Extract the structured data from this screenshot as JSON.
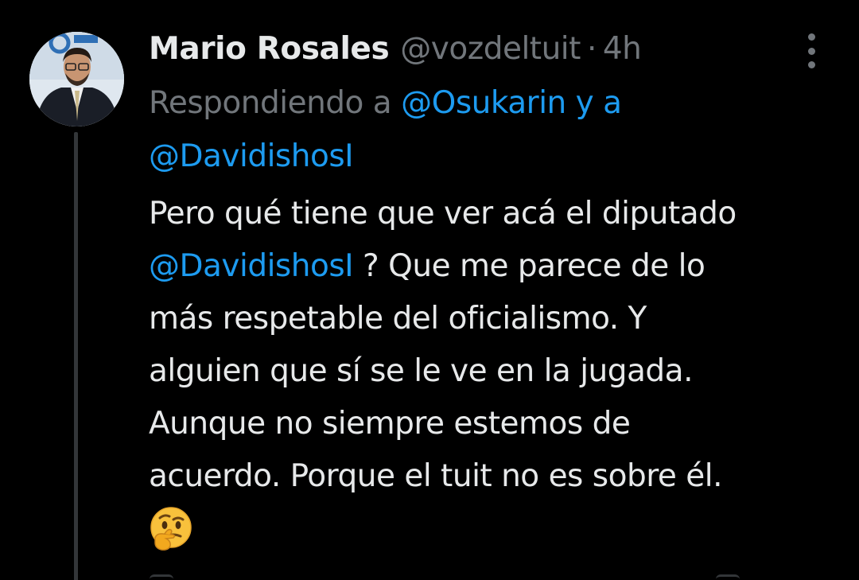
{
  "tweet": {
    "author_name": "Mario Rosales",
    "author_handle": "@vozdeltuit",
    "separator": "·",
    "timestamp": "4h",
    "replying_prefix": "Respondiendo a",
    "replying_mention_1": "@Osukarin",
    "replying_joiner": "y a",
    "replying_mention_2": "@DavidishosI",
    "body_lines": {
      "l1": "Pero qué tiene que ver acá el diputado",
      "l2_mention": "@DavidishosI",
      "l2_rest": " ? Que me parece de lo",
      "l3": "más respetable del oficialismo. Y",
      "l4": "alguien que sí se le ve en la jugada.",
      "l5": "Aunque no siempre estemos de",
      "l6": "acuerdo. Porque el tuit no es sobre él."
    },
    "emoji": "thinking-face-icon"
  },
  "icons": {
    "more": "more-options-icon",
    "avatar": "avatar"
  },
  "colors": {
    "background": "#000000",
    "primary_text": "#e7e9ea",
    "secondary_text": "#71767b",
    "link": "#1d9bf0",
    "thread_line": "#333639"
  }
}
